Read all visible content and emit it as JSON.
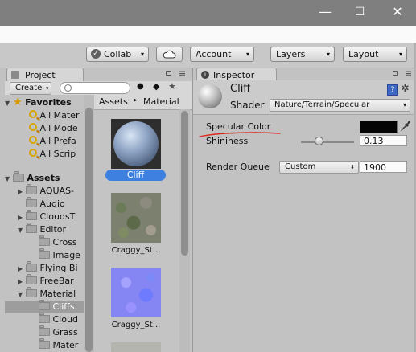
{
  "window": {
    "minimize_icon": "—",
    "maximize_icon": "☐",
    "close_icon": "✕"
  },
  "toolbar": {
    "collab_label": "Collab",
    "account_label": "Account",
    "layers_label": "Layers",
    "layout_label": "Layout",
    "dropdown_arrow": "▾"
  },
  "project": {
    "tab_label": "Project",
    "create_label": "Create",
    "breadcrumb": [
      "Assets",
      "Material"
    ],
    "breadcrumb_sep": "▸",
    "favorites_label": "Favorites",
    "favorites": [
      "All Mater",
      "All Mode",
      "All Prefa",
      "All Scrip"
    ],
    "assets_label": "Assets",
    "tree": [
      {
        "label": "AQUAS-"
      },
      {
        "label": "Audio"
      },
      {
        "label": "CloudsT"
      },
      {
        "label": "Editor"
      },
      {
        "label": "Cross"
      },
      {
        "label": "Image"
      },
      {
        "label": "Flying Bi"
      },
      {
        "label": "FreeBar"
      },
      {
        "label": "Material"
      },
      {
        "label": "Cliffs"
      },
      {
        "label": "Cloud"
      },
      {
        "label": "Grass"
      },
      {
        "label": "Mater"
      }
    ],
    "grid_items": [
      {
        "label": "Cliff"
      },
      {
        "label": "Craggy_St..."
      },
      {
        "label": "Craggy_St..."
      }
    ]
  },
  "inspector": {
    "tab_label": "Inspector",
    "material_name": "Cliff",
    "shader_label": "Shader",
    "shader_value": "Nature/Terrain/Specular",
    "specular_label": "Specular Color",
    "specular_color": "#050505",
    "shininess_label": "Shininess",
    "shininess_value": "0.13",
    "shininess_fraction": 0.33,
    "render_queue_label": "Render Queue",
    "render_queue_mode": "Custom",
    "render_queue_value": "1900"
  },
  "colors": {
    "selection_blue": "#3d80df",
    "annotation_red": "#e0281e"
  }
}
